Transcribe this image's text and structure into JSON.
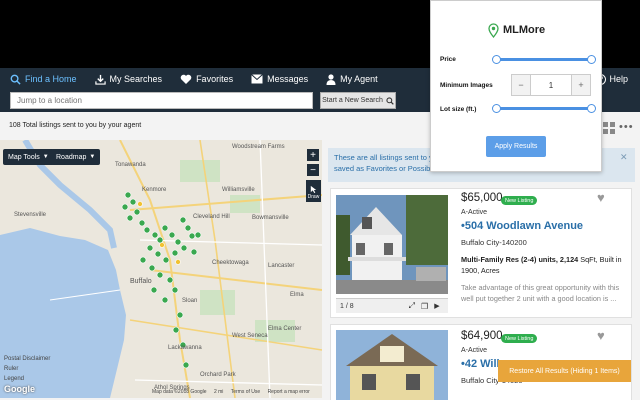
{
  "nav": {
    "items": [
      {
        "label": "Find a Home",
        "icon": "search-icon"
      },
      {
        "label": "My Searches",
        "icon": "download-icon"
      },
      {
        "label": "Favorites",
        "icon": "heart-icon"
      },
      {
        "label": "Messages",
        "icon": "envelope-icon"
      },
      {
        "label": "My Agent",
        "icon": "person-icon"
      }
    ],
    "help": "Help"
  },
  "search": {
    "placeholder": "Jump to a location",
    "new_search": "Start a New Search"
  },
  "summary": "108 Total listings sent to you by your agent",
  "map": {
    "tools": "Map Tools",
    "type": "Roadmap",
    "zoom_in": "+",
    "zoom_out": "−",
    "draw": "Draw",
    "legend": [
      "Postal Disclaimer",
      "Ruler",
      "Legend"
    ],
    "google": "Google",
    "footer": [
      "Map data ©2018 Google",
      "2 mi",
      "Terms of Use",
      "Report a map error"
    ],
    "labels": [
      "Woodstream Farms",
      "Kenmore",
      "Williamsville",
      "Bowmansville",
      "Cheektowaga",
      "Lancaster",
      "Buffalo",
      "Sloan",
      "West Seneca",
      "Elma Center",
      "Lackawanna",
      "Orchard Park",
      "Stevensville",
      "Tonawanda",
      "Cleveland Hill",
      "Elma",
      "Athol Springs"
    ]
  },
  "info": {
    "line1": "These are all listings sent to you",
    "line2": "saved as Favorites or Possibilities"
  },
  "listings": [
    {
      "price": "$65,000",
      "badge": "New Listing",
      "status": "A-Active",
      "address": "•504 Woodlawn Avenue",
      "city": "Buffalo City-140200",
      "desc_bold": "Multi-Family Res (2-4) units, 2,124",
      "desc_rest": " SqFt, Built in 1900, Acres",
      "remarks": "Take advantage of this great opportunity with this well put together 2 unit with a good location is ...",
      "photo_count": "1 / 8"
    },
    {
      "price": "$64,900",
      "badge": "New Listing",
      "status": "A-Active",
      "address": "•42 Wilk",
      "city": "Buffalo City-14020"
    }
  ],
  "restore": "Restore All Results (Hiding 1 Items)",
  "popup": {
    "title": "MLMore",
    "price_label": "Price",
    "min_images_label": "Minimum Images",
    "min_images_value": "1",
    "lot_size_label": "Lot size (ft.)",
    "apply": "Apply Results"
  },
  "colors": {
    "nav": "#1f2d3a",
    "accent": "#4a90e2",
    "badge": "#2fae4e",
    "restore": "#e8a53b"
  }
}
